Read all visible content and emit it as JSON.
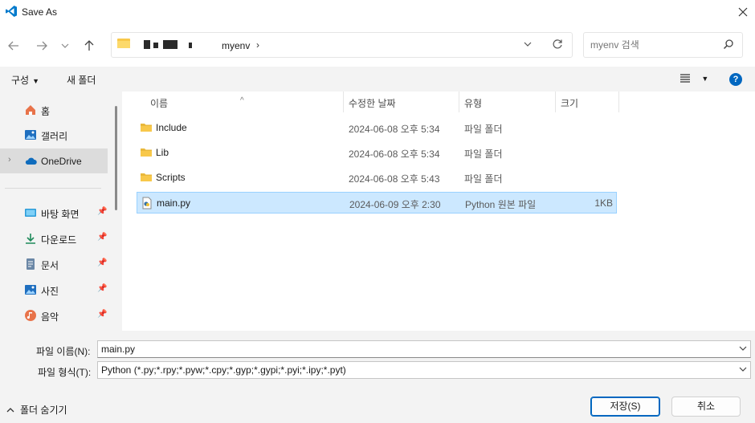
{
  "window": {
    "title": "Save As"
  },
  "address": {
    "crumb": "myenv",
    "crumb_sep": "›"
  },
  "search": {
    "placeholder": "myenv 검색"
  },
  "toolbar": {
    "organize_label": "구성",
    "new_folder_label": "새 폴더",
    "help_label": "?"
  },
  "nav": {
    "quick": [
      {
        "label": "홈",
        "icon": "home-icon"
      },
      {
        "label": "갤러리",
        "icon": "gallery-icon"
      },
      {
        "label": "OneDrive",
        "icon": "cloud-icon",
        "selected": true
      }
    ],
    "pinned": [
      {
        "label": "바탕 화면",
        "icon": "desktop-icon"
      },
      {
        "label": "다운로드",
        "icon": "download-icon"
      },
      {
        "label": "문서",
        "icon": "document-icon"
      },
      {
        "label": "사진",
        "icon": "pictures-icon"
      },
      {
        "label": "음악",
        "icon": "music-icon"
      }
    ]
  },
  "columns": {
    "name": "이름",
    "date": "수정한 날짜",
    "type": "유형",
    "size": "크기"
  },
  "files": [
    {
      "name": "Include",
      "date": "2024-06-08 오후 5:34",
      "type": "파일 폴더",
      "size": "",
      "kind": "folder"
    },
    {
      "name": "Lib",
      "date": "2024-06-08 오후 5:34",
      "type": "파일 폴더",
      "size": "",
      "kind": "folder"
    },
    {
      "name": "Scripts",
      "date": "2024-06-08 오후 5:43",
      "type": "파일 폴더",
      "size": "",
      "kind": "folder"
    },
    {
      "name": "main.py",
      "date": "2024-06-09 오후 2:30",
      "type": "Python 원본 파일",
      "size": "1KB",
      "kind": "python",
      "selected": true
    }
  ],
  "form": {
    "filename_label": "파일 이름(N):",
    "filename_value": "main.py",
    "filetype_label": "파일 형식(T):",
    "filetype_value": "Python (*.py;*.rpy;*.pyw;*.cpy;*.gyp;*.gypi;*.pyi;*.ipy;*.pyt)",
    "hide_folders_label": "폴더 숨기기",
    "save_label": "저장(S)",
    "cancel_label": "취소"
  },
  "colors": {
    "accent": "#0067c0",
    "vscode_blue": "#007acc",
    "folder": "#f8c84a",
    "selection": "#cce8ff"
  }
}
